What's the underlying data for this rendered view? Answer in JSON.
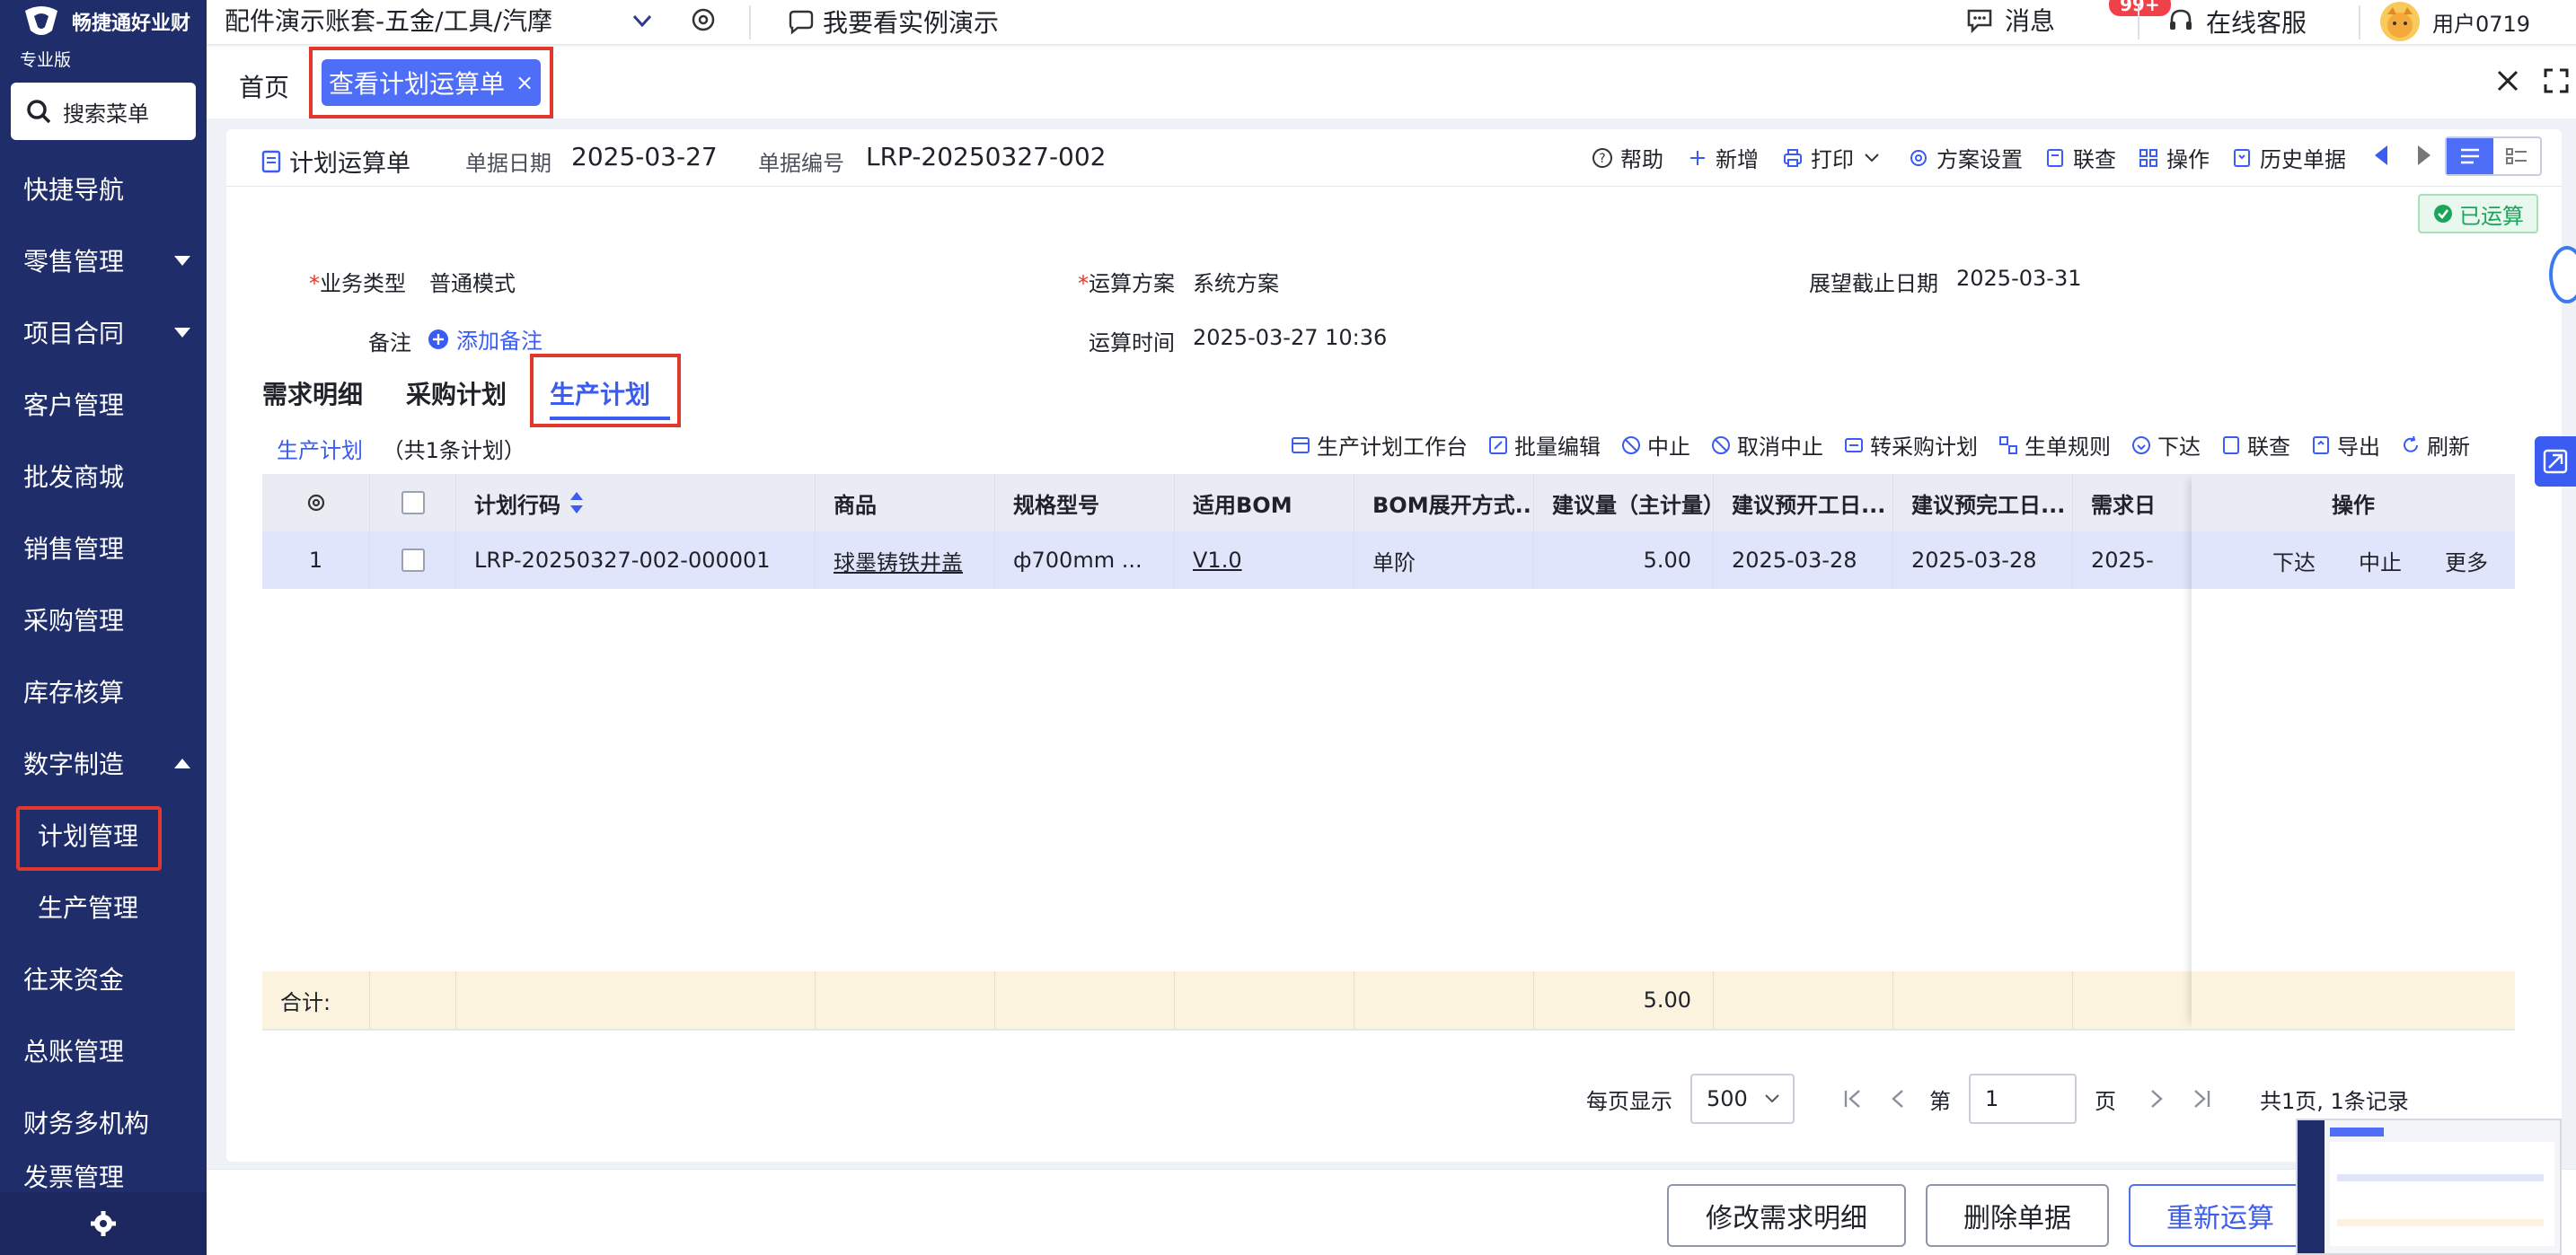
{
  "brand": {
    "name": "畅捷通好业财",
    "edition": "专业版"
  },
  "search_menu": {
    "label": "搜索菜单",
    "icon": "search-icon"
  },
  "nav": {
    "items": [
      {
        "label": "快捷导航"
      },
      {
        "label": "零售管理"
      },
      {
        "label": "项目合同"
      },
      {
        "label": "客户管理"
      },
      {
        "label": "批发商城"
      },
      {
        "label": "销售管理"
      },
      {
        "label": "采购管理"
      },
      {
        "label": "库存核算"
      },
      {
        "label": "数字制造"
      },
      {
        "label": "往来资金"
      },
      {
        "label": "总账管理"
      },
      {
        "label": "财务多机构"
      },
      {
        "label": "发票管理"
      }
    ],
    "sub_items": [
      {
        "label": "计划管理"
      },
      {
        "label": "生产管理"
      }
    ]
  },
  "topbar": {
    "account": "配件演示账套-五金/工具/汽摩",
    "demo": "我要看实例演示",
    "messages": "消息",
    "message_badge": "99+",
    "service": "在线客服",
    "user": "用户0719"
  },
  "tabs": {
    "home": "首页",
    "active": "查看计划运算单",
    "close": "×"
  },
  "doc": {
    "title": "计划运算单",
    "date_label": "单据日期",
    "date": "2025-03-27",
    "no_label": "单据编号",
    "no": "LRP-20250327-002",
    "status": "已运算"
  },
  "toolbar": [
    "帮助",
    "新增",
    "打印",
    "方案设置",
    "联查",
    "操作",
    "历史单据"
  ],
  "form": {
    "biz_type_label": "业务类型",
    "biz_type": "普通模式",
    "scheme_label": "运算方案",
    "scheme": "系统方案",
    "deadline_label": "展望截止日期",
    "deadline": "2025-03-31",
    "remark_label": "备注",
    "add_remark": "添加备注",
    "calc_time_label": "运算时间",
    "calc_time": "2025-03-27 10:36"
  },
  "subtabs": [
    "需求明细",
    "采购计划",
    "生产计划"
  ],
  "list": {
    "title": "生产计划",
    "count": "（共1条计划）",
    "tools": [
      "生产计划工作台",
      "批量编辑",
      "中止",
      "取消中止",
      "转采购计划",
      "生单规则",
      "下达",
      "联查",
      "导出",
      "刷新"
    ]
  },
  "table": {
    "headers": [
      "计划行码",
      "商品",
      "规格型号",
      "适用BOM",
      "BOM展开方式...",
      "建议量（主计量）",
      "建议预开工日...",
      "建议预完工日...",
      "需求日"
    ],
    "op_header": "操作",
    "rows": [
      {
        "idx": "1",
        "code": "LRP-20250327-002-000001",
        "product": "球墨铸铁井盖",
        "spec": "ф700mm ...",
        "bom": "V1.0",
        "expand": "单阶",
        "qty": "5.00",
        "start": "2025-03-28",
        "finish": "2025-03-28",
        "demand": "2025-",
        "ops": [
          "下达",
          "中止",
          "更多"
        ]
      }
    ],
    "sum_label": "合计:",
    "sum_qty": "5.00"
  },
  "pagination": {
    "per_page_label": "每页显示",
    "per_page": "500",
    "page_prefix": "第",
    "page": "1",
    "page_suffix": "页",
    "summary": "共1页, 1条记录"
  },
  "footer": {
    "modify": "修改需求明细",
    "delete": "删除单据",
    "recalc": "重新运算"
  },
  "colors": {
    "sidebar": "#1f2d6b",
    "accent": "#4f6ef7",
    "highlight": "#e0382c",
    "success": "#19a55a"
  }
}
